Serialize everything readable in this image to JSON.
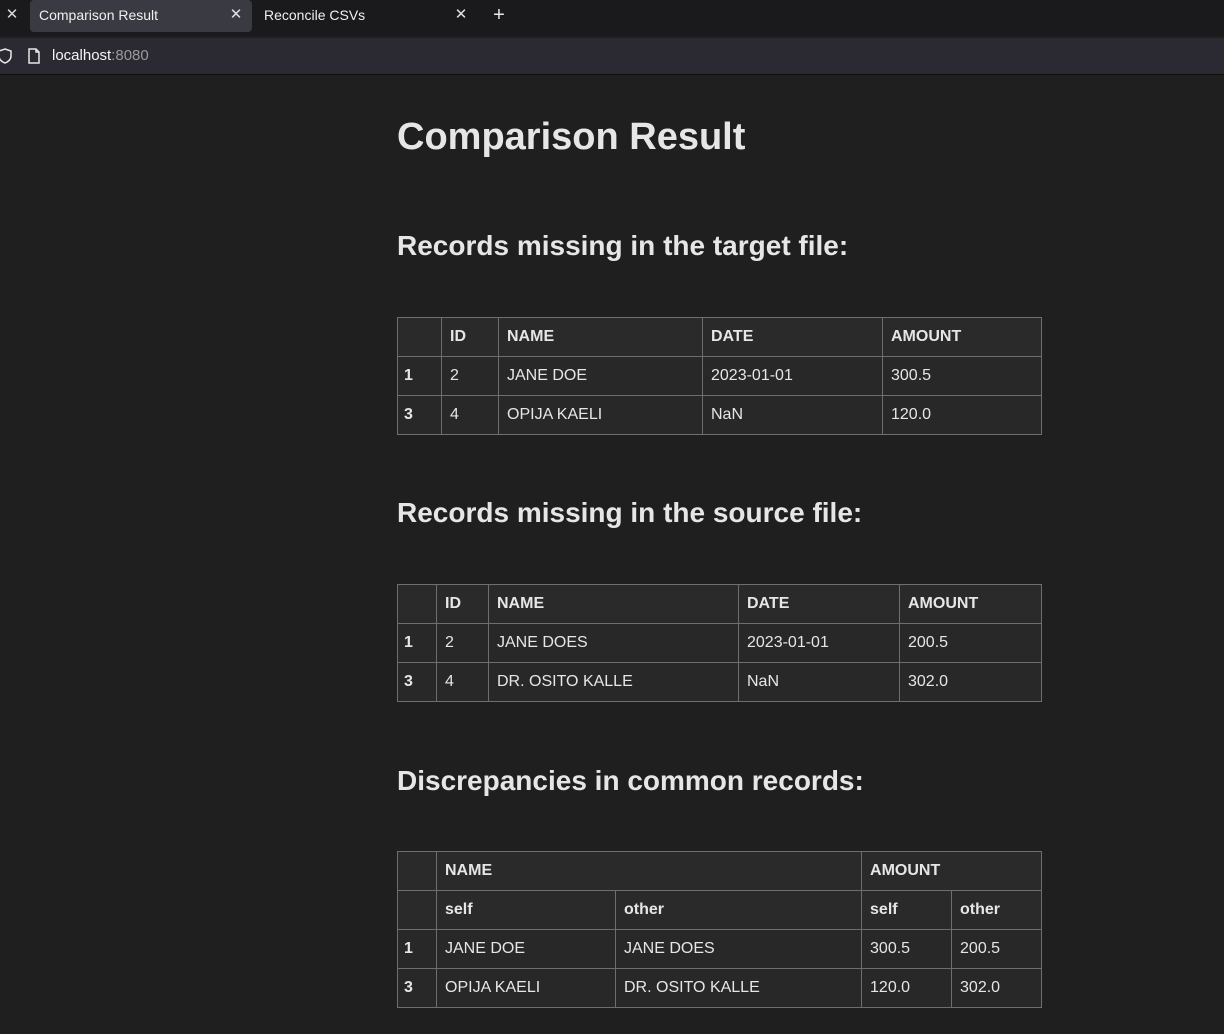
{
  "browser": {
    "tabs": [
      {
        "title": "Comparison Result",
        "active": true
      },
      {
        "title": "Reconcile CSVs",
        "active": false
      }
    ],
    "url": {
      "host": "localhost",
      "port": ":8080"
    }
  },
  "page": {
    "title": "Comparison Result",
    "section1": {
      "heading": "Records missing in the target file:",
      "columns": [
        "",
        "ID",
        "NAME",
        "DATE",
        "AMOUNT"
      ],
      "rows": [
        {
          "index": "1",
          "id": "2",
          "name": "JANE DOE",
          "date": "2023-01-01",
          "amount": "300.5"
        },
        {
          "index": "3",
          "id": "4",
          "name": "OPIJA KAELI",
          "date": "NaN",
          "amount": "120.0"
        }
      ]
    },
    "section2": {
      "heading": "Records missing in the source file:",
      "columns": [
        "",
        "ID",
        "NAME",
        "DATE",
        "AMOUNT"
      ],
      "rows": [
        {
          "index": "1",
          "id": "2",
          "name": "JANE DOES",
          "date": "2023-01-01",
          "amount": "200.5"
        },
        {
          "index": "3",
          "id": "4",
          "name": "DR. OSITO KALLE",
          "date": "NaN",
          "amount": "302.0"
        }
      ]
    },
    "section3": {
      "heading": "Discrepancies in common records:",
      "group_columns": [
        "NAME",
        "AMOUNT"
      ],
      "sub_columns": [
        "self",
        "other",
        "self",
        "other"
      ],
      "rows": [
        {
          "index": "1",
          "name_self": "JANE DOE",
          "name_other": "JANE DOES",
          "amount_self": "300.5",
          "amount_other": "200.5"
        },
        {
          "index": "3",
          "name_self": "OPIJA KAELI",
          "name_other": "DR. OSITO KALLE",
          "amount_self": "120.0",
          "amount_other": "302.0"
        }
      ]
    }
  }
}
